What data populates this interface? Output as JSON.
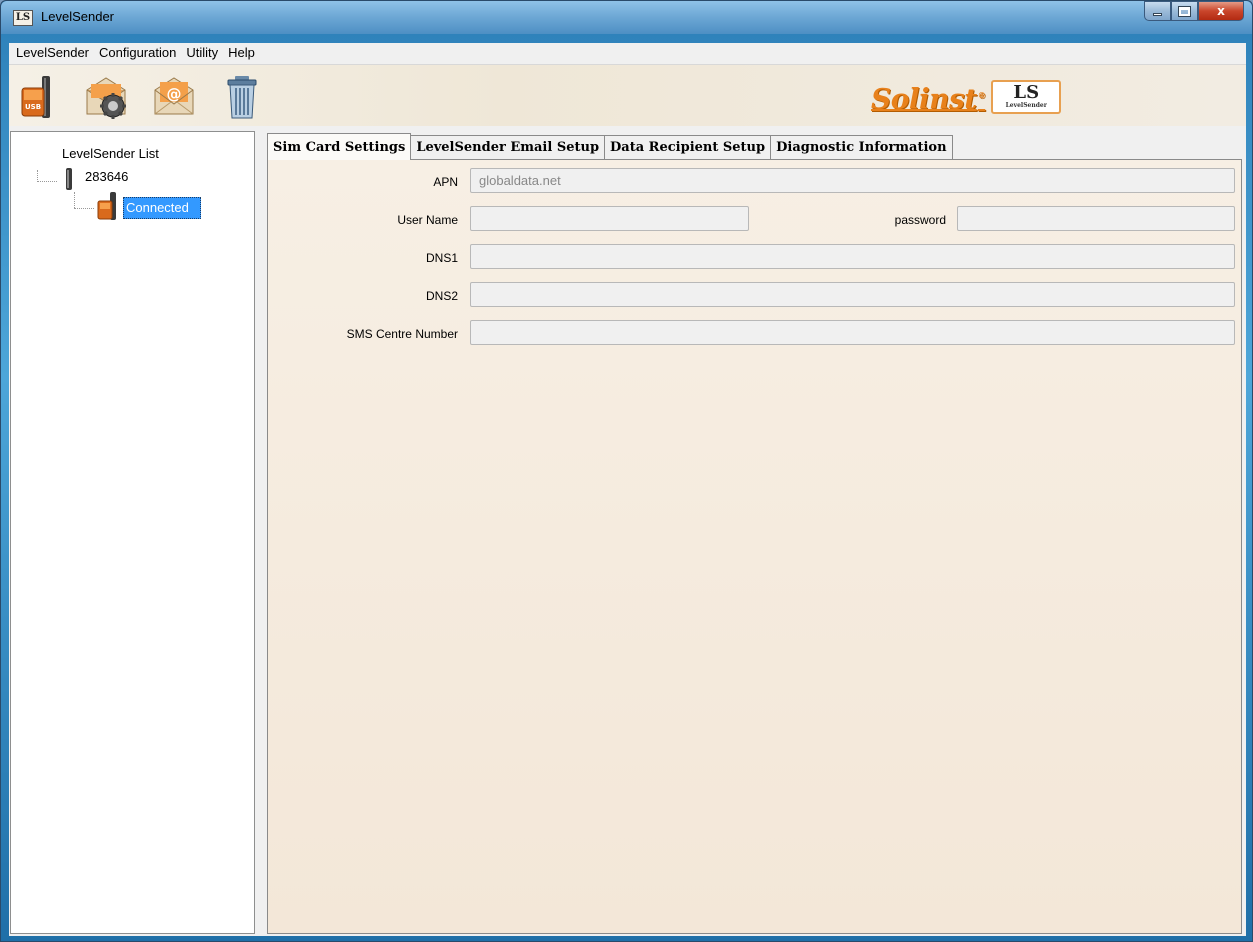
{
  "window": {
    "title": "LevelSender",
    "icon_text": "LS",
    "controls": {
      "close_symbol": "x"
    }
  },
  "menubar": {
    "items": [
      "LevelSender",
      "Configuration",
      "Utility",
      "Help"
    ]
  },
  "toolbar": {
    "buttons": [
      {
        "icon": "usb-levelsender-icon"
      },
      {
        "icon": "email-settings-gear-icon"
      },
      {
        "icon": "email-at-icon"
      },
      {
        "icon": "trash-can-icon"
      }
    ],
    "logo": {
      "brand": "Solinst",
      "registered": "®",
      "badge_main": "LS",
      "badge_sub": "LevelSender",
      "brand_color": "#e8811b"
    }
  },
  "tree": {
    "title": "LevelSender List",
    "device": "283646",
    "status": "Connected"
  },
  "tabs": [
    {
      "label": "Sim Card Settings",
      "active": true
    },
    {
      "label": "LevelSender Email Setup",
      "active": false
    },
    {
      "label": "Data Recipient Setup",
      "active": false
    },
    {
      "label": "Diagnostic Information",
      "active": false
    }
  ],
  "sim_settings": {
    "apn": {
      "label": "APN",
      "value": "globaldata.net"
    },
    "user_name": {
      "label": "User Name",
      "value": ""
    },
    "password": {
      "label": "password",
      "value": ""
    },
    "dns1": {
      "label": "DNS1",
      "value": ""
    },
    "dns2": {
      "label": "DNS2",
      "value": ""
    },
    "sms_centre": {
      "label": "SMS Centre Number",
      "value": ""
    }
  }
}
